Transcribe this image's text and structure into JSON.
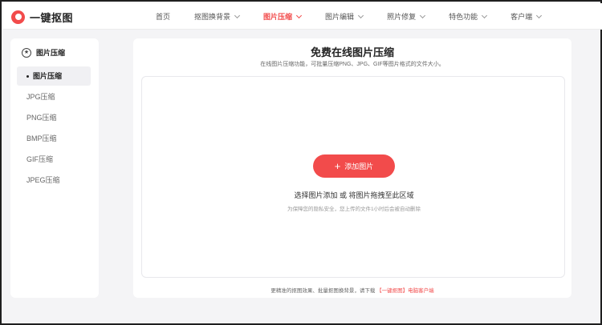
{
  "app": {
    "name": "一键抠图"
  },
  "nav": {
    "items": [
      {
        "label": "首页",
        "has_dropdown": false,
        "active": false
      },
      {
        "label": "抠图换背景",
        "has_dropdown": true,
        "active": false
      },
      {
        "label": "图片压缩",
        "has_dropdown": true,
        "active": true
      },
      {
        "label": "图片编辑",
        "has_dropdown": true,
        "active": false
      },
      {
        "label": "照片修复",
        "has_dropdown": true,
        "active": false
      },
      {
        "label": "特色功能",
        "has_dropdown": true,
        "active": false
      },
      {
        "label": "客户端",
        "has_dropdown": true,
        "active": false
      }
    ]
  },
  "sidebar": {
    "title": "图片压缩",
    "items": [
      {
        "label": "图片压缩",
        "active": true
      },
      {
        "label": "JPG压缩",
        "active": false
      },
      {
        "label": "PNG压缩",
        "active": false
      },
      {
        "label": "BMP压缩",
        "active": false
      },
      {
        "label": "GIF压缩",
        "active": false
      },
      {
        "label": "JPEG压缩",
        "active": false
      }
    ]
  },
  "main": {
    "title": "免费在线图片压缩",
    "subtitle": "在线图片压缩功能，可批量压缩PNG、JPG、GIF等图片格式的文件大小。",
    "add_button": "添加图片",
    "hint": "选择图片添加 或 将图片拖拽至此区域",
    "privacy": "为保障您的隐私安全，您上传的文件1小时后会被自动删除",
    "footer_text": "更精准的抠图效果、批量抠图换背景，请下载",
    "footer_link": "【一键抠图】电脑客户端"
  },
  "colors": {
    "accent": "#f24b4b",
    "background": "#f4f4f6"
  }
}
